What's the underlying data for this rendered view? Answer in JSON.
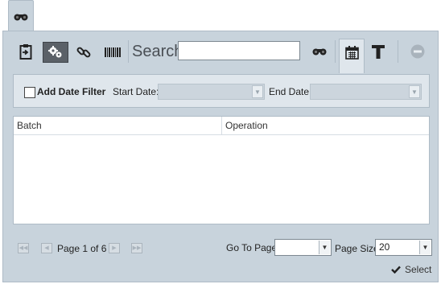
{
  "toolbar": {
    "search_label": "Search",
    "search_value": "",
    "icons": [
      "binoculars-icon",
      "clipboard-icon",
      "gears-icon",
      "link-icon",
      "barcode-icon",
      "binoculars-icon",
      "calendar-icon",
      "text-icon",
      "remove-icon"
    ]
  },
  "filter": {
    "add_date_filter_label": "Add Date Filter",
    "add_date_filter_checked": false,
    "start_date_label": "Start Date:",
    "start_date_value": "",
    "end_date_label": "End Date:",
    "end_date_value": ""
  },
  "grid": {
    "columns": [
      "Batch",
      "Operation"
    ],
    "rows": []
  },
  "pager": {
    "page_info": "Page 1 of 6",
    "go_to_page_label": "Go To Page",
    "go_to_page_value": "",
    "page_size_label": "Page Size",
    "page_size_value": "20"
  },
  "footer": {
    "select_label": "Select"
  }
}
